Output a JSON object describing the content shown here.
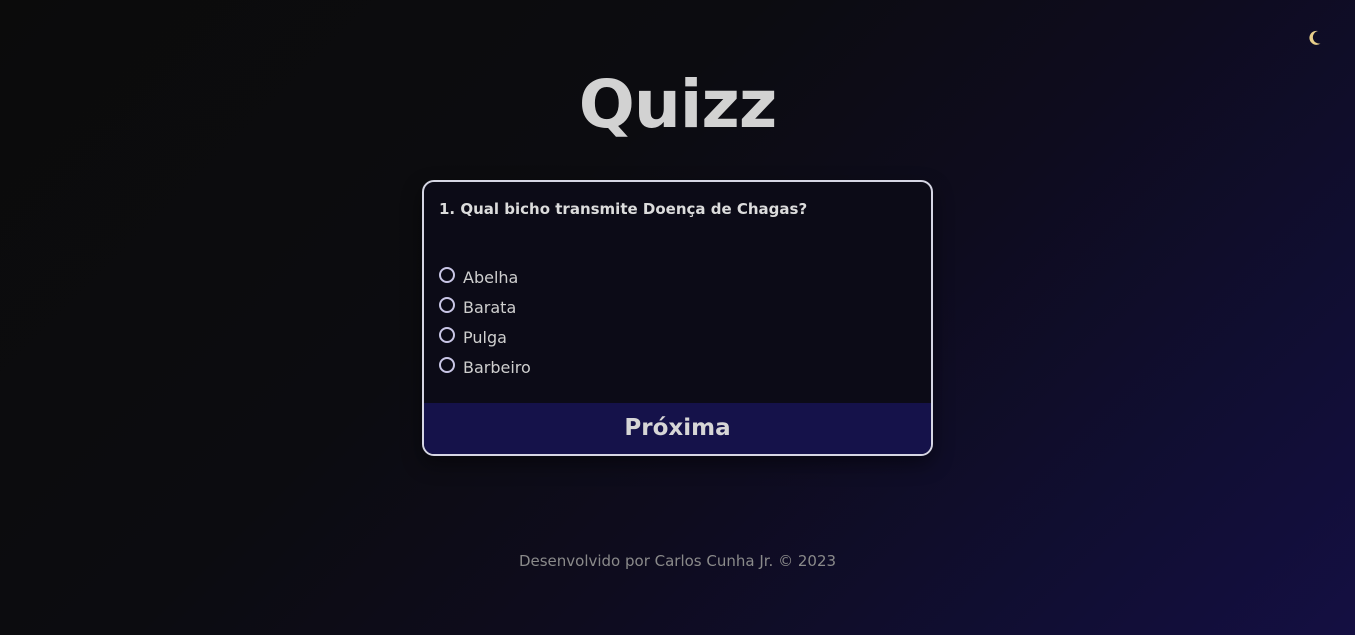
{
  "header": {
    "title": "Quizz",
    "theme_toggle_icon": "moon-icon"
  },
  "quiz": {
    "question": "1. Qual bicho transmite Doença de Chagas?",
    "options": [
      {
        "label": "Abelha"
      },
      {
        "label": "Barata"
      },
      {
        "label": "Pulga"
      },
      {
        "label": "Barbeiro"
      }
    ],
    "next_label": "Próxima"
  },
  "footer": {
    "text": "Desenvolvido por Carlos Cunha Jr. © 2023"
  },
  "colors": {
    "button_bg": "#15124a",
    "card_border": "#d6d6e4",
    "moon": "#e8cf8a"
  }
}
